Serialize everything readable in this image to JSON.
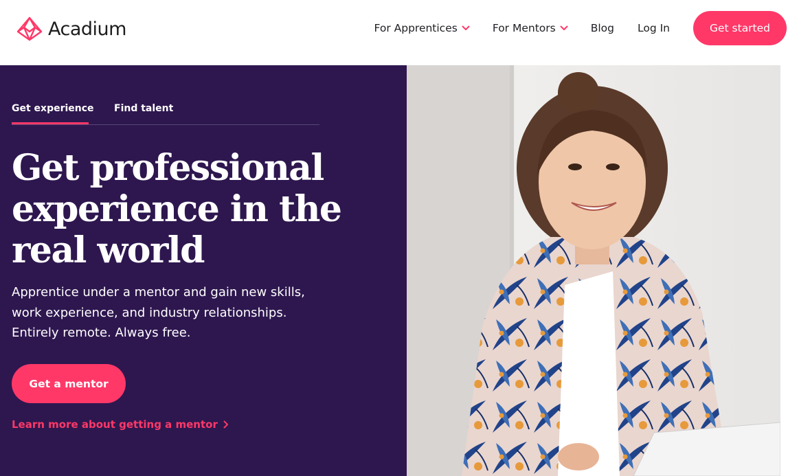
{
  "brand": {
    "name": "Acadium",
    "accent_color": "#ff3868",
    "hero_bg_color": "#2e174f",
    "logo_icon": "diamond-lattice-logo-icon"
  },
  "nav": {
    "items": [
      {
        "label": "For Apprentices",
        "icon": "chevron-down-icon"
      },
      {
        "label": "For Mentors",
        "icon": "chevron-down-icon"
      },
      {
        "label": "Blog"
      },
      {
        "label": "Log In"
      }
    ],
    "cta_label": "Get started"
  },
  "hero": {
    "tabs": [
      {
        "label": "Get experience",
        "active": true
      },
      {
        "label": "Find talent",
        "active": false
      }
    ],
    "headline": "Get professional experience in the real world",
    "subtext": "Apprentice under a mentor and gain new skills, work experience, and industry relationships. Entirely remote. Always free.",
    "primary_button": "Get a mentor",
    "secondary_link": "Learn more about getting a mentor",
    "secondary_link_icon": "chevron-right-icon",
    "image_subject": "smiling young woman in patterned jacket"
  }
}
